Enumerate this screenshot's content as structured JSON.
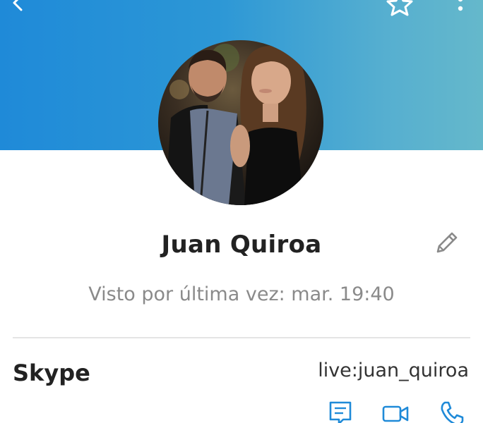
{
  "header": {
    "back_icon": "arrow-left-icon",
    "favorite_icon": "star-outline-icon",
    "more_icon": "more-vertical-icon",
    "gradient": [
      "#1f8ad8",
      "#65b8cb"
    ]
  },
  "profile": {
    "avatar": "contact-photo",
    "name": "Juan Quiroa",
    "edit_icon": "pencil-icon",
    "last_seen": "Visto por última vez: mar. 19:40"
  },
  "contact_method": {
    "service": "Skype",
    "identifier": "live:juan_quiroa",
    "actions": [
      {
        "icon": "message-icon"
      },
      {
        "icon": "video-call-icon"
      },
      {
        "icon": "phone-icon"
      }
    ],
    "accent_color": "#1f8ad8"
  }
}
